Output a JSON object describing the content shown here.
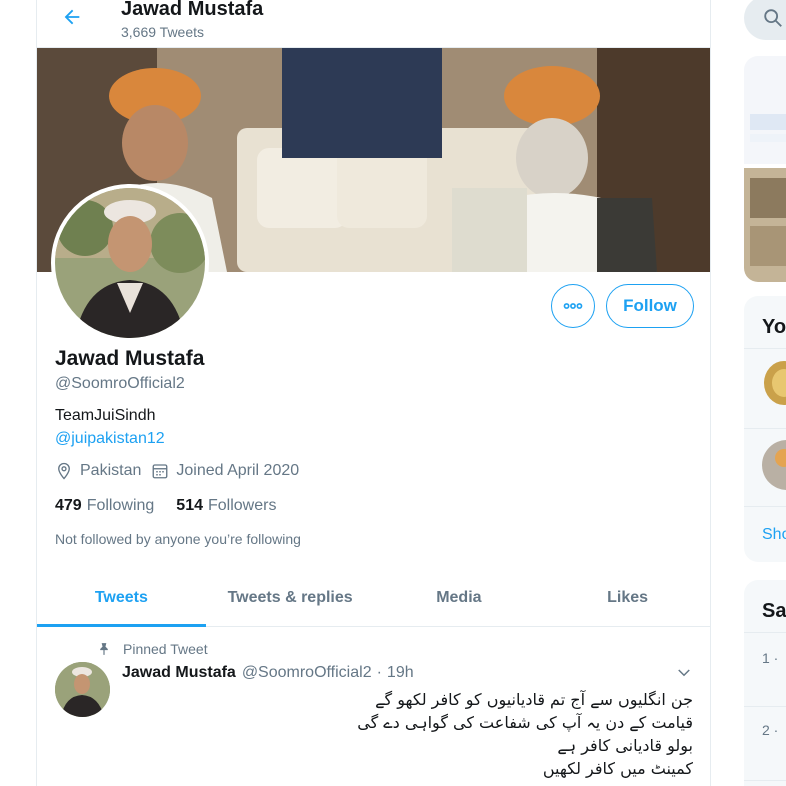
{
  "header": {
    "name": "Jawad Mustafa",
    "tweet_count": "3,669 Tweets",
    "back_icon": "arrow-left-icon"
  },
  "profile": {
    "name": "Jawad Mustafa",
    "handle": "@SoomroOfficial2",
    "bio": "TeamJuiSindh",
    "mention": "@juipakistan12",
    "location": "Pakistan",
    "joined": "Joined April 2020",
    "following_count": "479",
    "following_label": "Following",
    "followers_count": "514",
    "followers_label": "Followers",
    "followed_by_note": "Not followed by anyone you’re following",
    "follow_button": "Follow",
    "more_icon": "more-dots-icon"
  },
  "tabs": [
    {
      "label": "Tweets",
      "active": true
    },
    {
      "label": "Tweets & replies",
      "active": false
    },
    {
      "label": "Media",
      "active": false
    },
    {
      "label": "Likes",
      "active": false
    }
  ],
  "tweet": {
    "pinned_label": "Pinned Tweet",
    "author_name": "Jawad Mustafa",
    "author_handle": "@SoomroOfficial2",
    "separator": "·",
    "time": "19h",
    "lines": [
      "جن انگلیوں سے آج تم قادیانیوں کو کافر لکھو گے",
      "قیامت کے دن یہ آپ کی شفاعت کی گواہی دے گی",
      "بولو قادیانی کافر ہے",
      "کمینٹ میں کافر لکھیں"
    ]
  },
  "sidebar": {
    "card2_heading": "Yo",
    "card2_link": "Sho",
    "card3_heading": "Sa",
    "card3_items": [
      "1 ·",
      "2 ·"
    ]
  },
  "colors": {
    "accent": "#1da1f2",
    "text_primary": "#14171a",
    "text_secondary": "#657786",
    "border": "#e6ecf0"
  }
}
